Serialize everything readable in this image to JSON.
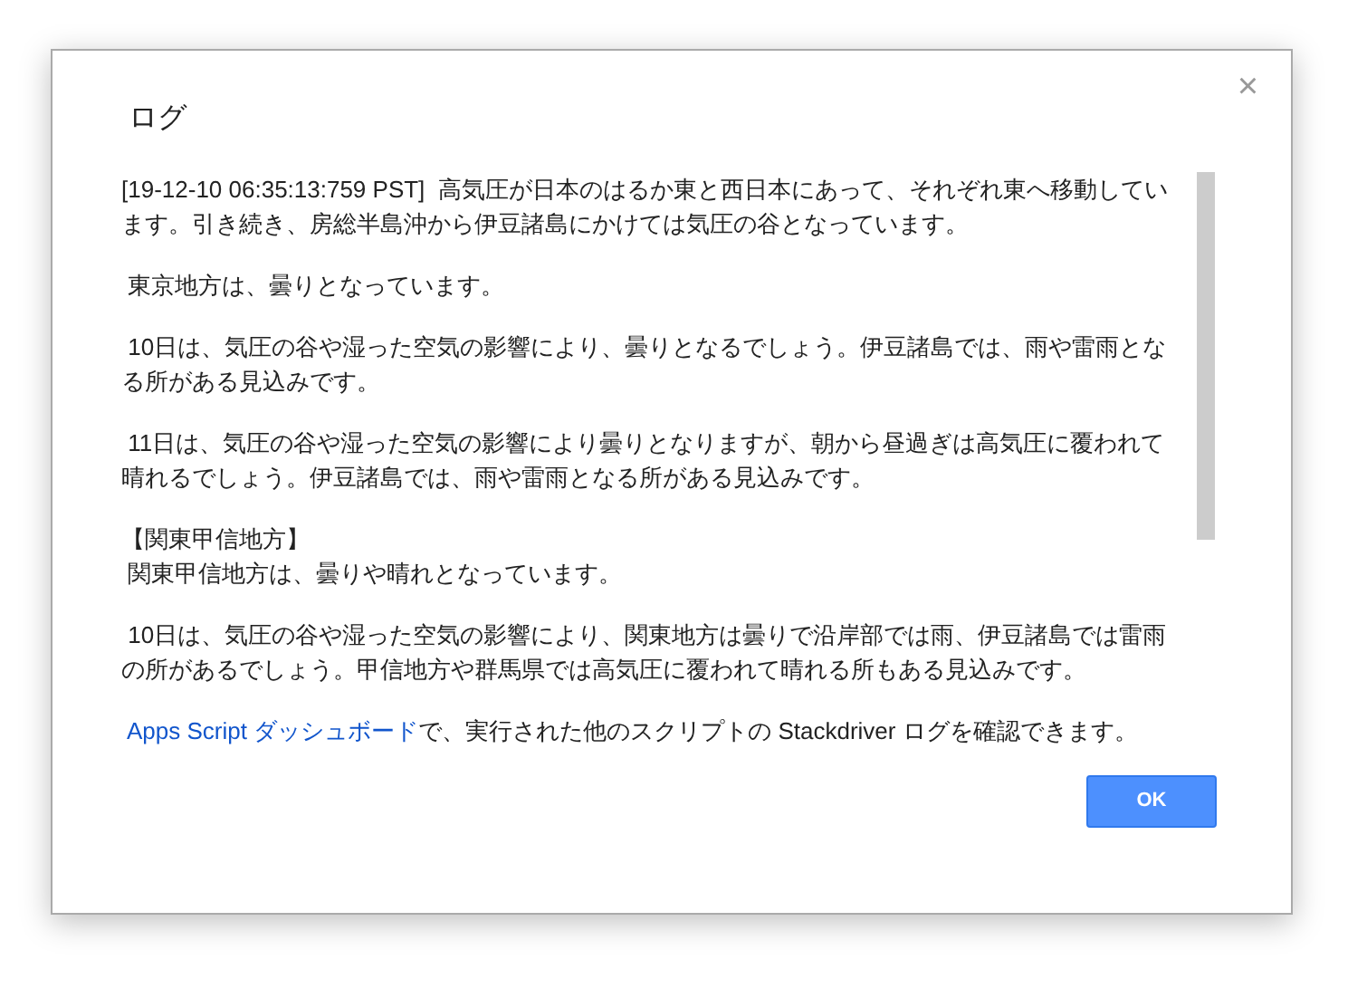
{
  "dialog": {
    "title": "ログ",
    "close": "×",
    "log": [
      "[19-12-10 06:35:13:759 PST]  高気圧が日本のはるか東と西日本にあって、それぞれ東へ移動しています。引き続き、房総半島沖から伊豆諸島にかけては気圧の谷となっています。",
      " 東京地方は、曇りとなっています。",
      " 10日は、気圧の谷や湿った空気の影響により、曇りとなるでしょう。伊豆諸島では、雨や雷雨となる所がある見込みです。",
      " 11日は、気圧の谷や湿った空気の影響により曇りとなりますが、朝から昼過ぎは高気圧に覆われて晴れるでしょう。伊豆諸島では、雨や雷雨となる所がある見込みです。",
      [
        "【関東甲信地方】",
        " 関東甲信地方は、曇りや晴れとなっています。"
      ],
      " 10日は、気圧の谷や湿った空気の影響により、関東地方は曇りで沿岸部では雨、伊豆諸島では雷雨の所があるでしょう。甲信地方や群馬県では高気圧に覆われて晴れる所もある見込みです。"
    ],
    "footer": {
      "link": "Apps Script ダッシュボード",
      "text": "で、実行された他のスクリプトの Stackdriver ログを確認できます。"
    },
    "button": "OK"
  }
}
